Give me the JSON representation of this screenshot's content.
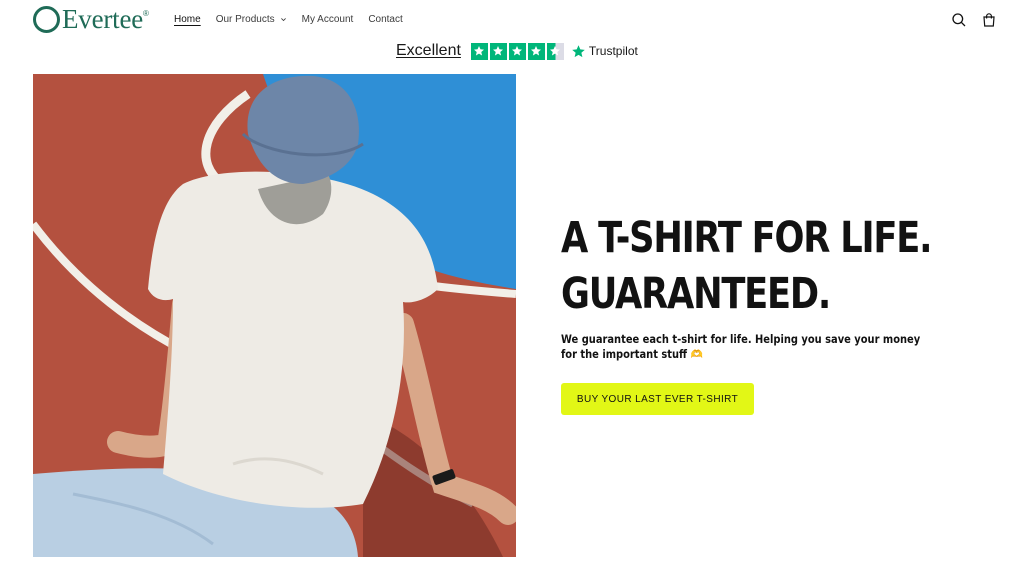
{
  "brand": {
    "name": "Evertee",
    "mark": "®",
    "color": "#1f6b57"
  },
  "nav": {
    "items": [
      {
        "label": "Home",
        "active": true
      },
      {
        "label": "Our Products",
        "has_dropdown": true
      },
      {
        "label": "My Account"
      },
      {
        "label": "Contact"
      }
    ]
  },
  "header_icons": {
    "search": "search-icon",
    "cart": "cart-icon"
  },
  "trustpilot": {
    "rating_word": "Excellent",
    "stars": 4.5,
    "brand": "Trustpilot",
    "star_color": "#00b67a"
  },
  "hero": {
    "image_alt": "Man in white t-shirt and denim cap sitting on a running track",
    "headline_line1": "A T-SHIRT FOR LIFE.",
    "headline_line2": "GUARANTEED.",
    "subtext": "We guarantee each t-shirt for life. Helping you save your money for the important stuff 🫶",
    "cta_label": "BUY YOUR LAST EVER T-SHIRT",
    "cta_color": "#e2f716"
  }
}
